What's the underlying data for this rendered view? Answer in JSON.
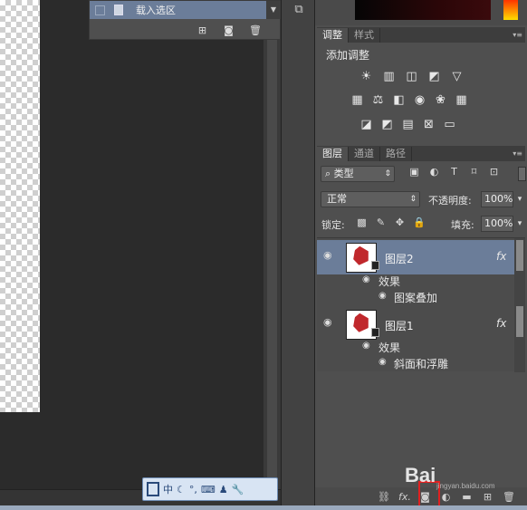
{
  "channels_panel": {
    "row_label": "载入选区"
  },
  "adjustments_panel": {
    "tabs": [
      "调整",
      "样式"
    ],
    "title": "添加调整",
    "rows": [
      [
        "brightness-icon",
        "levels-icon",
        "curves-icon",
        "exposure-icon",
        "vibrance-icon"
      ],
      [
        "hue-saturation-icon",
        "color-balance-icon",
        "black-white-icon",
        "photo-filter-icon",
        "channel-mixer-icon",
        "color-lookup-icon"
      ],
      [
        "invert-icon",
        "posterize-icon",
        "threshold-icon",
        "selective-color-icon",
        "gradient-map-icon"
      ]
    ]
  },
  "layers_panel": {
    "tabs": [
      "图层",
      "通道",
      "路径"
    ],
    "filter_label": "类型",
    "blend_mode": "正常",
    "opacity_label": "不透明度:",
    "opacity_value": "100%",
    "lock_label": "锁定:",
    "fill_label": "填充:",
    "fill_value": "100%",
    "layers": [
      {
        "name": "图层2",
        "selected": true,
        "fx": "fx",
        "effects_label": "效果",
        "effects": [
          "图案叠加"
        ]
      },
      {
        "name": "图层1",
        "selected": false,
        "fx": "fx",
        "effects_label": "效果",
        "effects": [
          "斜面和浮雕"
        ]
      }
    ],
    "footer_fx": "fx."
  },
  "ime_toolbar": {
    "mode": "中"
  },
  "watermark": {
    "text": "Bai",
    "url": "jingyan.baidu.com"
  },
  "colors": {
    "selected_layer": "#6b7d99",
    "panel_bg": "#4f4f4f",
    "highlight": "#e02020"
  }
}
